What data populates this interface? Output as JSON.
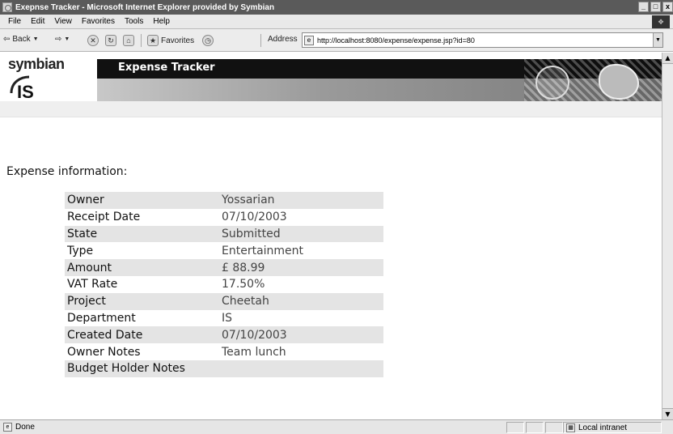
{
  "window": {
    "title": "Exepnse Tracker - Microsoft Internet Explorer provided by Symbian",
    "minimize_glyph": "_",
    "maximize_glyph": "□",
    "close_glyph": "x"
  },
  "menu": {
    "items": [
      "File",
      "Edit",
      "View",
      "Favorites",
      "Tools",
      "Help"
    ]
  },
  "toolbar": {
    "back_label": "Back",
    "favorites_label": "Favorites",
    "address_label": "Address",
    "address_value": "http://localhost:8080/expense/expense.jsp?id=80"
  },
  "banner": {
    "logo_text": "symbian",
    "logo_mark": "IS",
    "app_title": "Expense Tracker"
  },
  "content": {
    "heading": "Expense information:",
    "rows": [
      {
        "label": "Owner",
        "value": "Yossarian"
      },
      {
        "label": "Receipt Date",
        "value": "07/10/2003"
      },
      {
        "label": "State",
        "value": "Submitted"
      },
      {
        "label": "Type",
        "value": "Entertainment"
      },
      {
        "label": "Amount",
        "value": "£ 88.99"
      },
      {
        "label": "VAT Rate",
        "value": "17.50%"
      },
      {
        "label": "Project",
        "value": "Cheetah"
      },
      {
        "label": "Department",
        "value": "IS"
      },
      {
        "label": "Created Date",
        "value": "07/10/2003"
      },
      {
        "label": "Owner Notes",
        "value": "Team lunch"
      },
      {
        "label": "Budget Holder Notes",
        "value": ""
      }
    ]
  },
  "status": {
    "text": "Done",
    "zone": "Local intranet"
  }
}
